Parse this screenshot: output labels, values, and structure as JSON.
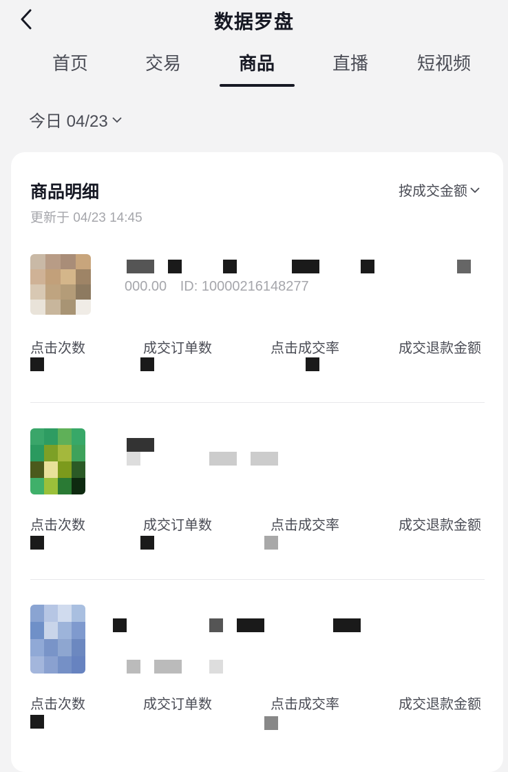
{
  "header": {
    "title": "数据罗盘"
  },
  "tabs": [
    {
      "label": "首页",
      "active": false
    },
    {
      "label": "交易",
      "active": false
    },
    {
      "label": "商品",
      "active": true
    },
    {
      "label": "直播",
      "active": false
    },
    {
      "label": "短视频",
      "active": false
    }
  ],
  "date_picker": {
    "label": "今日 04/23"
  },
  "card": {
    "title": "商品明细",
    "sort_label": "按成交金额",
    "updated": "更新于 04/23 14:45"
  },
  "metric_labels": [
    "点击次数",
    "成交订单数",
    "点击成交率",
    "成交退款金额"
  ],
  "products": [
    {
      "price_text": "000.00",
      "id_text": "ID: 10000216148277"
    },
    {
      "price_text": "",
      "id_text": ""
    },
    {
      "price_text": "",
      "id_text": ""
    }
  ],
  "colors": {
    "accent": "#161823",
    "muted": "#a5a6ab",
    "background": "#f3f3f4"
  }
}
